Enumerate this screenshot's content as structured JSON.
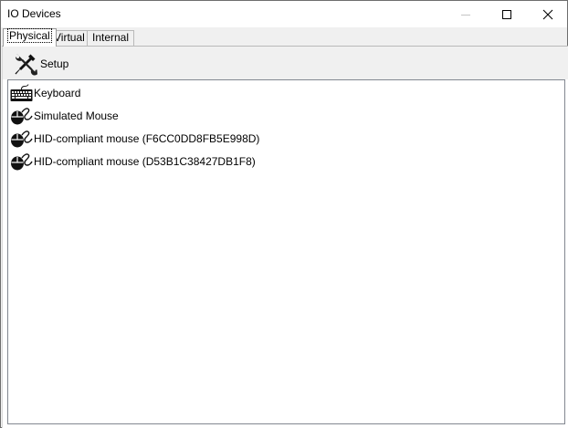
{
  "window": {
    "title": "IO Devices"
  },
  "tabs": [
    {
      "label": "Physical",
      "active": true
    },
    {
      "label": "Virtual",
      "active": false
    },
    {
      "label": "Internal",
      "active": false
    }
  ],
  "toolbar": {
    "setup_label": "Setup",
    "setup_icon": "wrench-screwdriver-icon"
  },
  "devices": [
    {
      "label": "Keyboard",
      "icon": "keyboard-icon"
    },
    {
      "label": "Simulated Mouse",
      "icon": "mouse-icon"
    },
    {
      "label": "HID-compliant mouse (F6CC0DD8FB5E998D)",
      "icon": "mouse-icon"
    },
    {
      "label": "HID-compliant mouse (D53B1C38427DB1F8)",
      "icon": "mouse-icon"
    }
  ]
}
